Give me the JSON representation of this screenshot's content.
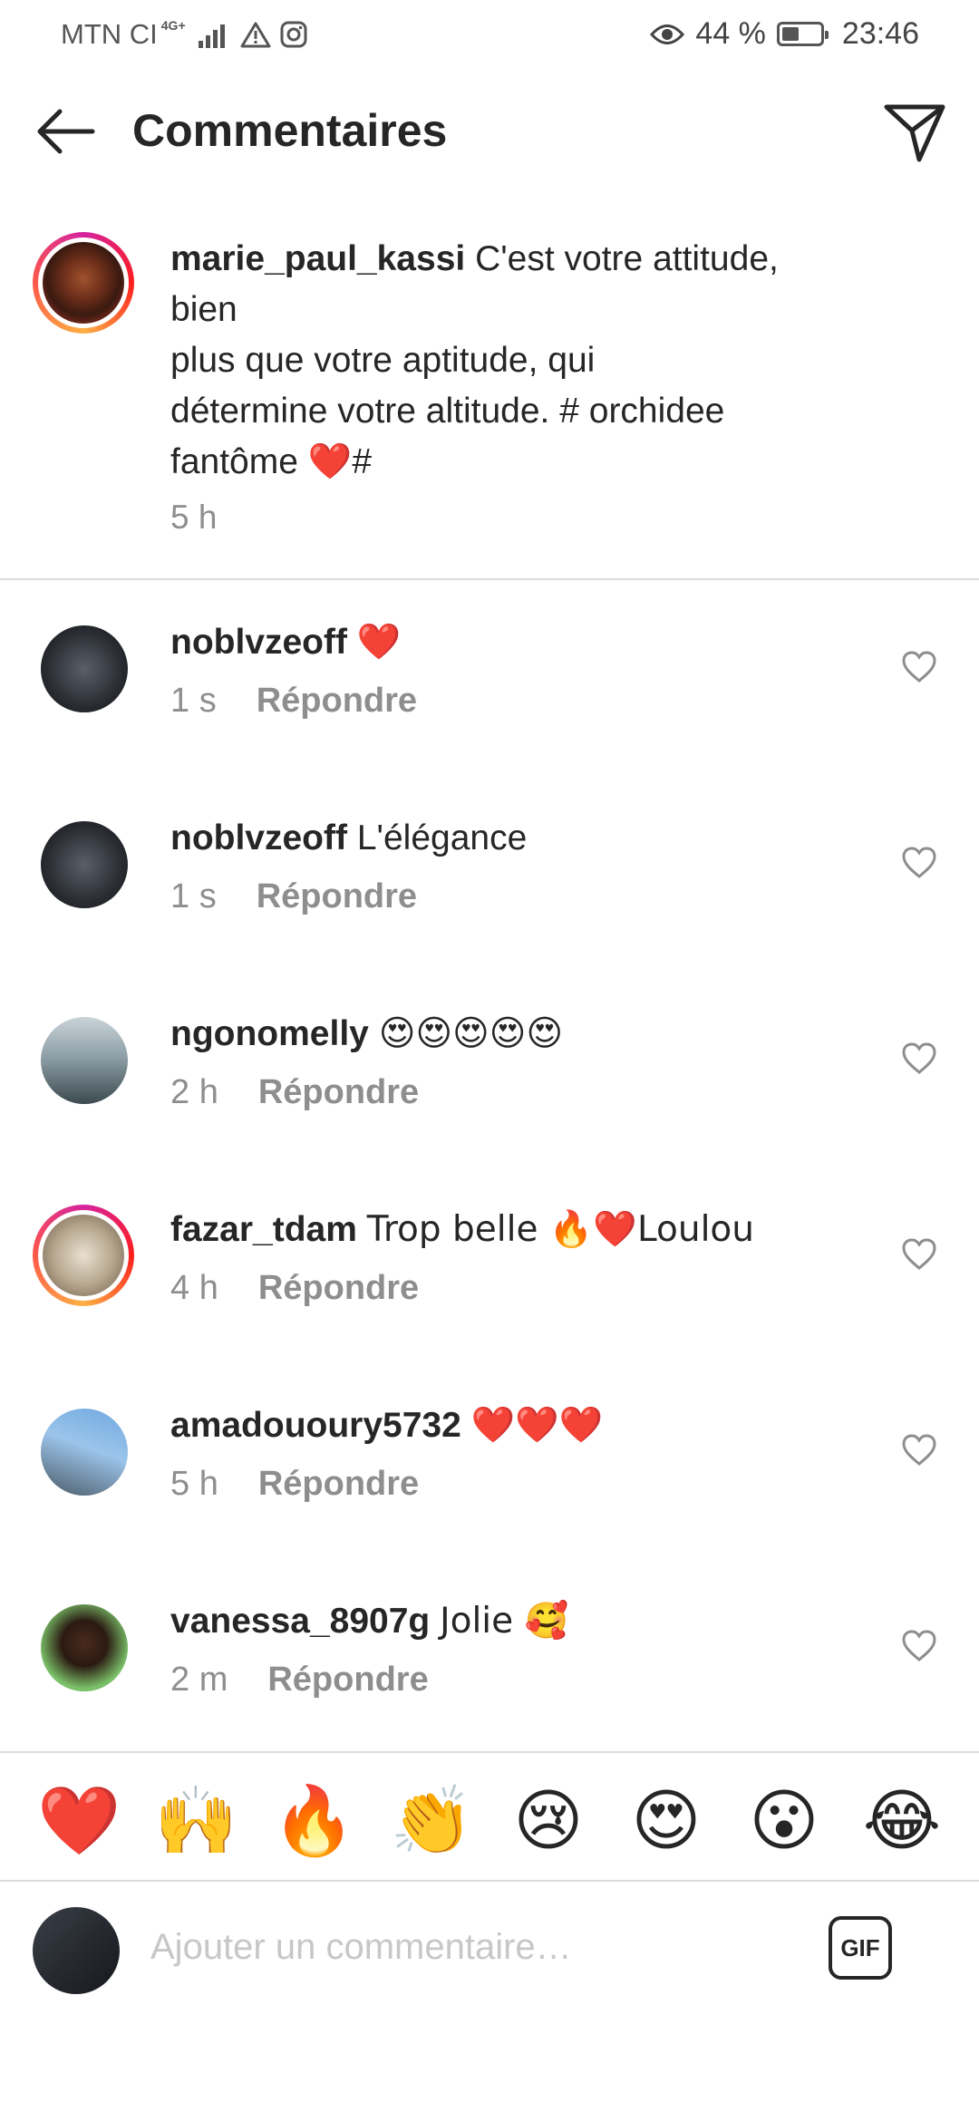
{
  "status_bar": {
    "carrier": "MTN CI",
    "network": "4G+",
    "battery": "44 %",
    "battery_level": 0.44,
    "time": "23:46"
  },
  "header": {
    "title": "Commentaires",
    "back_icon": "arrow-left-icon",
    "share_icon": "paper-plane-icon"
  },
  "caption": {
    "username": "marie_paul_kassi",
    "text_line1": "C'est votre attitude,",
    "text_line2": "bien",
    "text_line3": "plus que votre aptitude, qui",
    "text_line4": "détermine votre altitude. # orchidee",
    "text_line5_prefix": "fantôme",
    "text_line5_emoji": "❤️",
    "text_line5_suffix": "#",
    "time": "5 h"
  },
  "comments": [
    {
      "username": "noblvzeoff",
      "text": "❤️",
      "time": "1 s",
      "reply": "Répondre"
    },
    {
      "username": "noblvzeoff",
      "text": "L'élégance",
      "time": "1 s",
      "reply": "Répondre"
    },
    {
      "username": "ngonomelly",
      "text": "😍😍😍😍😍",
      "time": "2 h",
      "reply": "Répondre"
    },
    {
      "username": "fazar_tdam",
      "text": "Trop belle 🔥❤️Loulou",
      "time": "4 h",
      "reply": "Répondre"
    },
    {
      "username": "amadououry5732",
      "text": "❤️❤️❤️",
      "time": "5 h",
      "reply": "Répondre"
    },
    {
      "username": "vanessa_8907g",
      "text": "Jolie 🥰",
      "time": "2 m",
      "reply": "Répondre"
    }
  ],
  "quick_reactions": [
    "❤️",
    "🙌",
    "🔥",
    "👏",
    "😢",
    "😍",
    "😮",
    "😂"
  ],
  "composer": {
    "placeholder": "Ajouter un commentaire…",
    "gif_label": "GIF"
  },
  "colors": {
    "text": "#262626",
    "secondary": "#8e8e8e",
    "divider": "#dbdbdb",
    "placeholder": "#c7c7c7"
  }
}
